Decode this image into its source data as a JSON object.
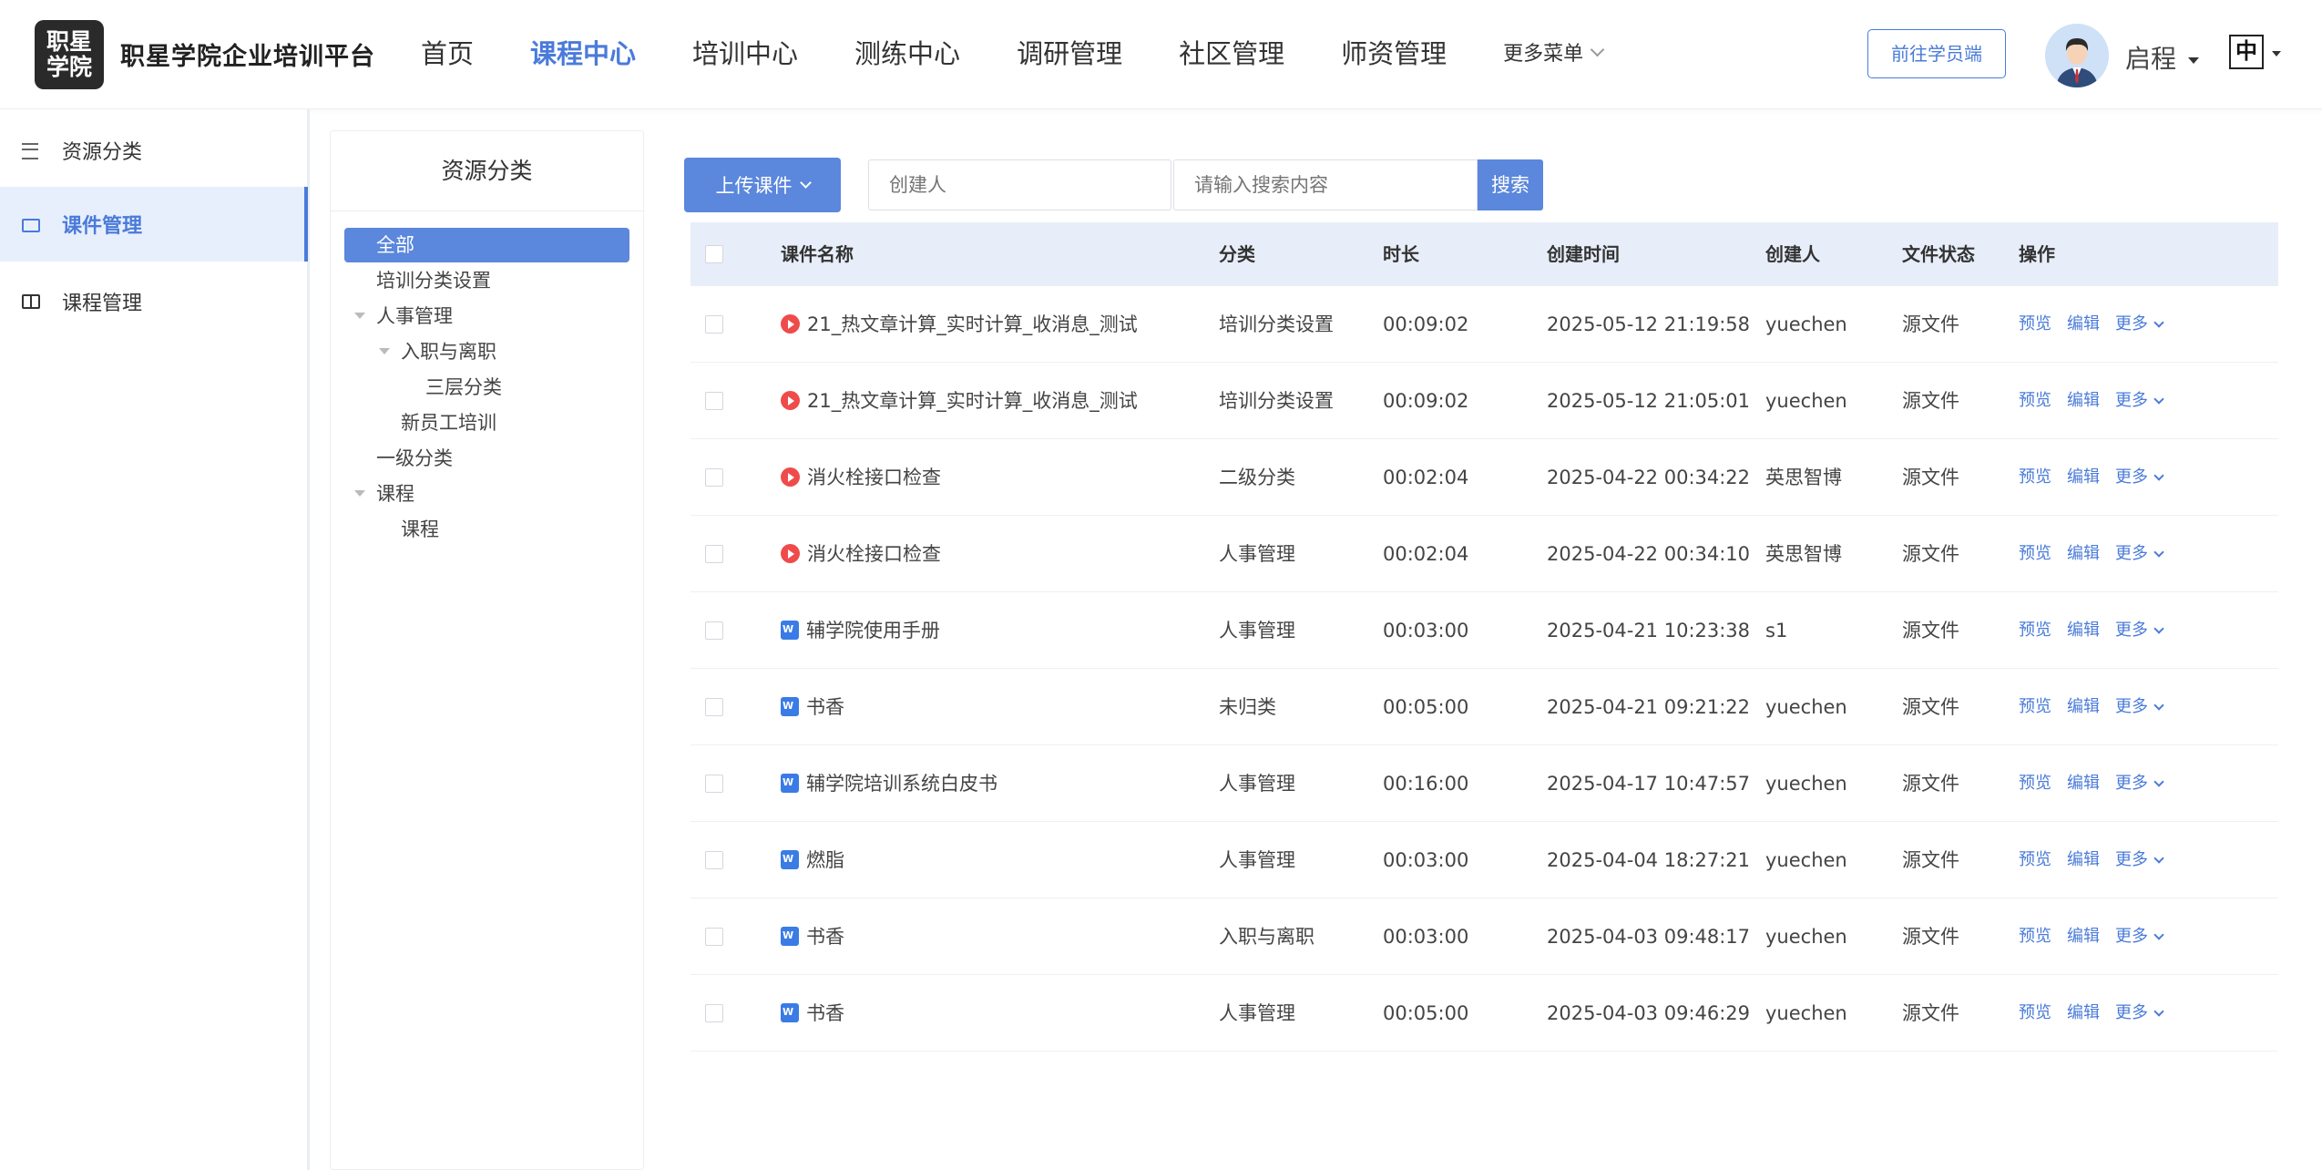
{
  "header": {
    "logo_line1": "职星",
    "logo_line2": "学院",
    "app_title": "职星学院企业培训平台",
    "nav": [
      "首页",
      "课程中心",
      "培训中心",
      "测练中心",
      "调研管理",
      "社区管理",
      "师资管理"
    ],
    "active_nav": "课程中心",
    "more_menu": "更多菜单",
    "student_button": "前往学员端",
    "username": "启程",
    "lang": "中"
  },
  "sidebar": {
    "items": [
      {
        "label": "资源分类",
        "icon": "list-icon"
      },
      {
        "label": "课件管理",
        "icon": "folder-icon",
        "active": true
      },
      {
        "label": "课程管理",
        "icon": "book-icon"
      }
    ]
  },
  "tree": {
    "title": "资源分类",
    "nodes": [
      "全部",
      "培训分类设置",
      "人事管理",
      "入职与离职",
      "三层分类",
      "新员工培训",
      "一级分类",
      "课程",
      "课程"
    ]
  },
  "toolbar": {
    "upload_label": "上传课件",
    "creator_placeholder": "创建人",
    "search_placeholder": "请输入搜索内容",
    "search_label": "搜索"
  },
  "table": {
    "headers": [
      "课件名称",
      "分类",
      "时长",
      "创建时间",
      "创建人",
      "文件状态",
      "操作"
    ],
    "rows": [
      {
        "type": "video",
        "name": "21_热文章计算_实时计算_收消息_测试",
        "category": "培训分类设置",
        "duration": "00:09:02",
        "created": "2025-05-12 21:19:58",
        "creator": "yuechen",
        "status": "源文件"
      },
      {
        "type": "video",
        "name": "21_热文章计算_实时计算_收消息_测试",
        "category": "培训分类设置",
        "duration": "00:09:02",
        "created": "2025-05-12 21:05:01",
        "creator": "yuechen",
        "status": "源文件"
      },
      {
        "type": "video",
        "name": "消火栓接口检查",
        "category": "二级分类",
        "duration": "00:02:04",
        "created": "2025-04-22 00:34:22",
        "creator": "英思智博",
        "status": "源文件"
      },
      {
        "type": "video",
        "name": "消火栓接口检查",
        "category": "人事管理",
        "duration": "00:02:04",
        "created": "2025-04-22 00:34:10",
        "creator": "英思智博",
        "status": "源文件"
      },
      {
        "type": "word",
        "name": "辅学院使用手册",
        "category": "人事管理",
        "duration": "00:03:00",
        "created": "2025-04-21 10:23:38",
        "creator": "s1",
        "status": "源文件"
      },
      {
        "type": "word",
        "name": "书香",
        "category": "未归类",
        "duration": "00:05:00",
        "created": "2025-04-21 09:21:22",
        "creator": "yuechen",
        "status": "源文件"
      },
      {
        "type": "word",
        "name": "辅学院培训系统白皮书",
        "category": "人事管理",
        "duration": "00:16:00",
        "created": "2025-04-17 10:47:57",
        "creator": "yuechen",
        "status": "源文件"
      },
      {
        "type": "word",
        "name": "燃脂",
        "category": "人事管理",
        "duration": "00:03:00",
        "created": "2025-04-04 18:27:21",
        "creator": "yuechen",
        "status": "源文件"
      },
      {
        "type": "word",
        "name": "书香",
        "category": "入职与离职",
        "duration": "00:03:00",
        "created": "2025-04-03 09:48:17",
        "creator": "yuechen",
        "status": "源文件"
      },
      {
        "type": "word",
        "name": "书香",
        "category": "人事管理",
        "duration": "00:05:00",
        "created": "2025-04-03 09:46:29",
        "creator": "yuechen",
        "status": "源文件"
      }
    ],
    "ops": {
      "preview": "预览",
      "edit": "编辑",
      "more": "更多"
    }
  },
  "colors": {
    "accent": "#4a7bd9",
    "button": "#5b87dc",
    "header_row": "#e8eef9",
    "video_icon": "#ef4b4b",
    "word_icon": "#3a7be6"
  }
}
